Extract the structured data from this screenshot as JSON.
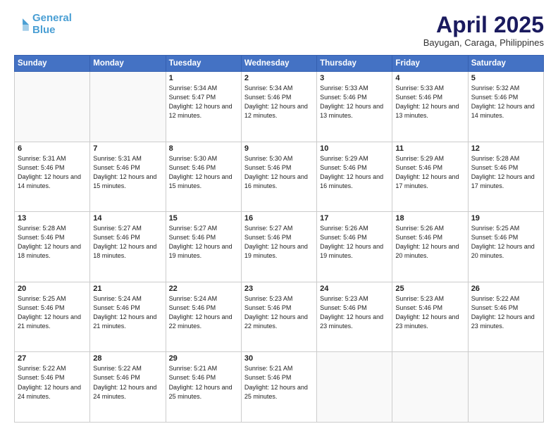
{
  "header": {
    "logo_line1": "General",
    "logo_line2": "Blue",
    "month_title": "April 2025",
    "location": "Bayugan, Caraga, Philippines"
  },
  "weekdays": [
    "Sunday",
    "Monday",
    "Tuesday",
    "Wednesday",
    "Thursday",
    "Friday",
    "Saturday"
  ],
  "weeks": [
    [
      {
        "day": "",
        "sunrise": "",
        "sunset": "",
        "daylight": ""
      },
      {
        "day": "",
        "sunrise": "",
        "sunset": "",
        "daylight": ""
      },
      {
        "day": "1",
        "sunrise": "Sunrise: 5:34 AM",
        "sunset": "Sunset: 5:47 PM",
        "daylight": "Daylight: 12 hours and 12 minutes."
      },
      {
        "day": "2",
        "sunrise": "Sunrise: 5:34 AM",
        "sunset": "Sunset: 5:46 PM",
        "daylight": "Daylight: 12 hours and 12 minutes."
      },
      {
        "day": "3",
        "sunrise": "Sunrise: 5:33 AM",
        "sunset": "Sunset: 5:46 PM",
        "daylight": "Daylight: 12 hours and 13 minutes."
      },
      {
        "day": "4",
        "sunrise": "Sunrise: 5:33 AM",
        "sunset": "Sunset: 5:46 PM",
        "daylight": "Daylight: 12 hours and 13 minutes."
      },
      {
        "day": "5",
        "sunrise": "Sunrise: 5:32 AM",
        "sunset": "Sunset: 5:46 PM",
        "daylight": "Daylight: 12 hours and 14 minutes."
      }
    ],
    [
      {
        "day": "6",
        "sunrise": "Sunrise: 5:31 AM",
        "sunset": "Sunset: 5:46 PM",
        "daylight": "Daylight: 12 hours and 14 minutes."
      },
      {
        "day": "7",
        "sunrise": "Sunrise: 5:31 AM",
        "sunset": "Sunset: 5:46 PM",
        "daylight": "Daylight: 12 hours and 15 minutes."
      },
      {
        "day": "8",
        "sunrise": "Sunrise: 5:30 AM",
        "sunset": "Sunset: 5:46 PM",
        "daylight": "Daylight: 12 hours and 15 minutes."
      },
      {
        "day": "9",
        "sunrise": "Sunrise: 5:30 AM",
        "sunset": "Sunset: 5:46 PM",
        "daylight": "Daylight: 12 hours and 16 minutes."
      },
      {
        "day": "10",
        "sunrise": "Sunrise: 5:29 AM",
        "sunset": "Sunset: 5:46 PM",
        "daylight": "Daylight: 12 hours and 16 minutes."
      },
      {
        "day": "11",
        "sunrise": "Sunrise: 5:29 AM",
        "sunset": "Sunset: 5:46 PM",
        "daylight": "Daylight: 12 hours and 17 minutes."
      },
      {
        "day": "12",
        "sunrise": "Sunrise: 5:28 AM",
        "sunset": "Sunset: 5:46 PM",
        "daylight": "Daylight: 12 hours and 17 minutes."
      }
    ],
    [
      {
        "day": "13",
        "sunrise": "Sunrise: 5:28 AM",
        "sunset": "Sunset: 5:46 PM",
        "daylight": "Daylight: 12 hours and 18 minutes."
      },
      {
        "day": "14",
        "sunrise": "Sunrise: 5:27 AM",
        "sunset": "Sunset: 5:46 PM",
        "daylight": "Daylight: 12 hours and 18 minutes."
      },
      {
        "day": "15",
        "sunrise": "Sunrise: 5:27 AM",
        "sunset": "Sunset: 5:46 PM",
        "daylight": "Daylight: 12 hours and 19 minutes."
      },
      {
        "day": "16",
        "sunrise": "Sunrise: 5:27 AM",
        "sunset": "Sunset: 5:46 PM",
        "daylight": "Daylight: 12 hours and 19 minutes."
      },
      {
        "day": "17",
        "sunrise": "Sunrise: 5:26 AM",
        "sunset": "Sunset: 5:46 PM",
        "daylight": "Daylight: 12 hours and 19 minutes."
      },
      {
        "day": "18",
        "sunrise": "Sunrise: 5:26 AM",
        "sunset": "Sunset: 5:46 PM",
        "daylight": "Daylight: 12 hours and 20 minutes."
      },
      {
        "day": "19",
        "sunrise": "Sunrise: 5:25 AM",
        "sunset": "Sunset: 5:46 PM",
        "daylight": "Daylight: 12 hours and 20 minutes."
      }
    ],
    [
      {
        "day": "20",
        "sunrise": "Sunrise: 5:25 AM",
        "sunset": "Sunset: 5:46 PM",
        "daylight": "Daylight: 12 hours and 21 minutes."
      },
      {
        "day": "21",
        "sunrise": "Sunrise: 5:24 AM",
        "sunset": "Sunset: 5:46 PM",
        "daylight": "Daylight: 12 hours and 21 minutes."
      },
      {
        "day": "22",
        "sunrise": "Sunrise: 5:24 AM",
        "sunset": "Sunset: 5:46 PM",
        "daylight": "Daylight: 12 hours and 22 minutes."
      },
      {
        "day": "23",
        "sunrise": "Sunrise: 5:23 AM",
        "sunset": "Sunset: 5:46 PM",
        "daylight": "Daylight: 12 hours and 22 minutes."
      },
      {
        "day": "24",
        "sunrise": "Sunrise: 5:23 AM",
        "sunset": "Sunset: 5:46 PM",
        "daylight": "Daylight: 12 hours and 23 minutes."
      },
      {
        "day": "25",
        "sunrise": "Sunrise: 5:23 AM",
        "sunset": "Sunset: 5:46 PM",
        "daylight": "Daylight: 12 hours and 23 minutes."
      },
      {
        "day": "26",
        "sunrise": "Sunrise: 5:22 AM",
        "sunset": "Sunset: 5:46 PM",
        "daylight": "Daylight: 12 hours and 23 minutes."
      }
    ],
    [
      {
        "day": "27",
        "sunrise": "Sunrise: 5:22 AM",
        "sunset": "Sunset: 5:46 PM",
        "daylight": "Daylight: 12 hours and 24 minutes."
      },
      {
        "day": "28",
        "sunrise": "Sunrise: 5:22 AM",
        "sunset": "Sunset: 5:46 PM",
        "daylight": "Daylight: 12 hours and 24 minutes."
      },
      {
        "day": "29",
        "sunrise": "Sunrise: 5:21 AM",
        "sunset": "Sunset: 5:46 PM",
        "daylight": "Daylight: 12 hours and 25 minutes."
      },
      {
        "day": "30",
        "sunrise": "Sunrise: 5:21 AM",
        "sunset": "Sunset: 5:46 PM",
        "daylight": "Daylight: 12 hours and 25 minutes."
      },
      {
        "day": "",
        "sunrise": "",
        "sunset": "",
        "daylight": ""
      },
      {
        "day": "",
        "sunrise": "",
        "sunset": "",
        "daylight": ""
      },
      {
        "day": "",
        "sunrise": "",
        "sunset": "",
        "daylight": ""
      }
    ]
  ]
}
